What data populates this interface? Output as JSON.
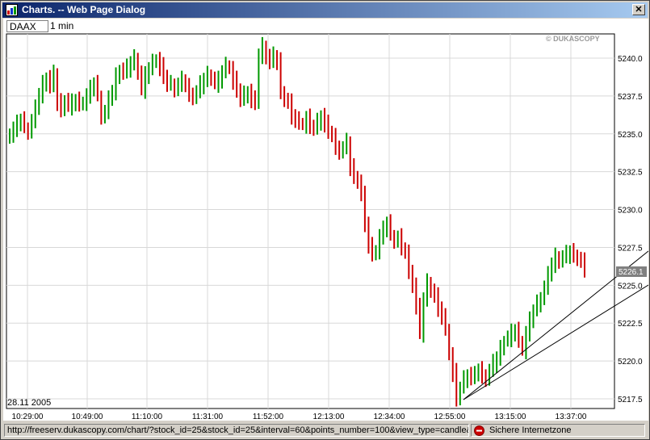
{
  "window": {
    "title": "Charts. -- Web Page Dialog",
    "close_label": "✕"
  },
  "toolbar": {
    "symbol": "DAAX",
    "interval": "1 min"
  },
  "chart": {
    "watermark": "© DUKASCOPY",
    "date_label": "28.11 2005",
    "last_price_label": "5226.1"
  },
  "status": {
    "url": "http://freeserv.dukascopy.com/chart/?stock_id=25&stock_id=25&interval=60&points_number=100&view_type=candle&wi",
    "zone": "Sichere Internetzone"
  },
  "colors": {
    "up": "#009900",
    "down": "#cc0000",
    "grid": "#d8d8d8",
    "line": "#000000",
    "price_tag": "#808080"
  },
  "chart_data": {
    "type": "line",
    "series_style": "candle-bars",
    "x_ticks": [
      "10:29:00",
      "10:49:00",
      "11:10:00",
      "11:31:00",
      "11:52:00",
      "12:13:00",
      "12:34:00",
      "12:55:00",
      "13:15:00",
      "13:37:00"
    ],
    "y_ticks": [
      "5240.0",
      "5237.5",
      "5235.0",
      "5232.5",
      "5230.0",
      "5227.5",
      "5225.0",
      "5222.5",
      "5220.0",
      "5217.5"
    ],
    "ylim": [
      5217.0,
      5241.5
    ],
    "close_values": [
      5235.0,
      5235.3,
      5235.6,
      5235.9,
      5235.4,
      5235.2,
      5235.8,
      5236.6,
      5237.6,
      5238.3,
      5238.7,
      5238.1,
      5238.9,
      5237.1,
      5236.6,
      5237.2,
      5236.8,
      5237.0,
      5237.2,
      5236.9,
      5237.1,
      5237.5,
      5237.9,
      5238.3,
      5237.5,
      5236.2,
      5236.4,
      5237.2,
      5237.8,
      5238.8,
      5239.2,
      5239.0,
      5239.3,
      5239.7,
      5240.0,
      5239.0,
      5237.9,
      5238.8,
      5239.3,
      5239.7,
      5239.9,
      5239.4,
      5238.8,
      5238.2,
      5238.3,
      5238.0,
      5238.2,
      5238.5,
      5238.1,
      5237.7,
      5237.4,
      5237.7,
      5238.2,
      5238.6,
      5238.9,
      5238.6,
      5238.3,
      5238.5,
      5239.1,
      5239.5,
      5239.3,
      5238.5,
      5237.9,
      5237.2,
      5237.6,
      5237.8,
      5237.2,
      5237.0,
      5240.2,
      5240.8,
      5240.1,
      5239.7,
      5240.1,
      5239.8,
      5237.8,
      5237.2,
      5237.0,
      5236.2,
      5235.9,
      5235.7,
      5235.6,
      5236.0,
      5235.5,
      5235.3,
      5235.8,
      5236.2,
      5235.6,
      5235.1,
      5234.8,
      5234.2,
      5233.8,
      5234.0,
      5234.4,
      5232.8,
      5232.2,
      5231.8,
      5230.9,
      5229.1,
      5227.6,
      5227.0,
      5227.3,
      5228.2,
      5228.6,
      5229.1,
      5228.3,
      5228.0,
      5228.1,
      5227.4,
      5227.1,
      5226.0,
      5225.0,
      5223.5,
      5221.8,
      5224.1,
      5225.2,
      5224.6,
      5224.2,
      5223.5,
      5222.9,
      5222.1,
      5220.4,
      5219.2,
      5217.5,
      5218.2,
      5218.8,
      5219.1,
      5218.9,
      5219.0,
      5219.4,
      5219.1,
      5218.8,
      5219.3,
      5219.8,
      5220.2,
      5220.8,
      5221.3,
      5221.5,
      5221.8,
      5222.0,
      5221.3,
      5220.7,
      5221.8,
      5222.6,
      5223.3,
      5223.8,
      5224.2,
      5224.8,
      5225.6,
      5226.4,
      5226.9,
      5226.6,
      5226.8,
      5227.0,
      5227.2,
      5227.0,
      5226.7,
      5226.5,
      5226.1
    ]
  }
}
